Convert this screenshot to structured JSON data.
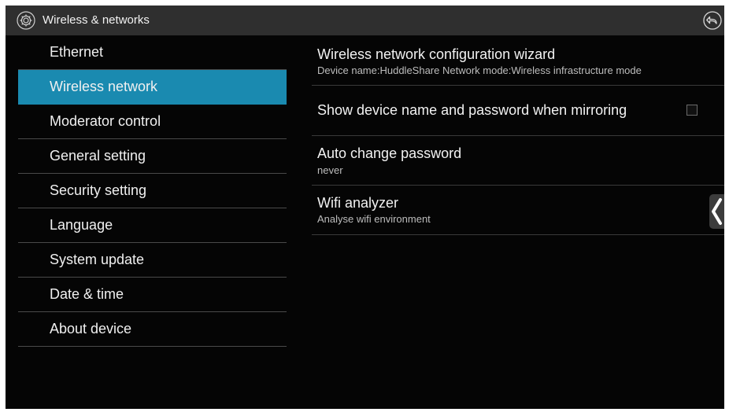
{
  "header": {
    "title": "Wireless & networks",
    "settings_icon": "gear-icon",
    "back_icon": "back-icon"
  },
  "sidebar": {
    "items": [
      {
        "label": "Ethernet"
      },
      {
        "label": "Wireless network",
        "selected": true
      },
      {
        "label": "Moderator control"
      },
      {
        "label": "General setting"
      },
      {
        "label": "Security setting"
      },
      {
        "label": "Language"
      },
      {
        "label": "System update"
      },
      {
        "label": "Date & time"
      },
      {
        "label": "About device"
      }
    ]
  },
  "main": {
    "rows": [
      {
        "title": "Wireless network configuration wizard",
        "summary": "Device name:HuddleShare   Network mode:Wireless infrastructure mode"
      },
      {
        "title": "Show device name and password when mirroring",
        "checked": false
      },
      {
        "title": "Auto change password",
        "summary": "never"
      },
      {
        "title": "Wifi analyzer",
        "summary": "Analyse wifi environment"
      }
    ]
  },
  "side_tab": {
    "icon": "chevron-left-icon"
  },
  "colors": {
    "accent": "#1a8ab0",
    "background": "#050505",
    "topbar": "#2f2f2f"
  }
}
